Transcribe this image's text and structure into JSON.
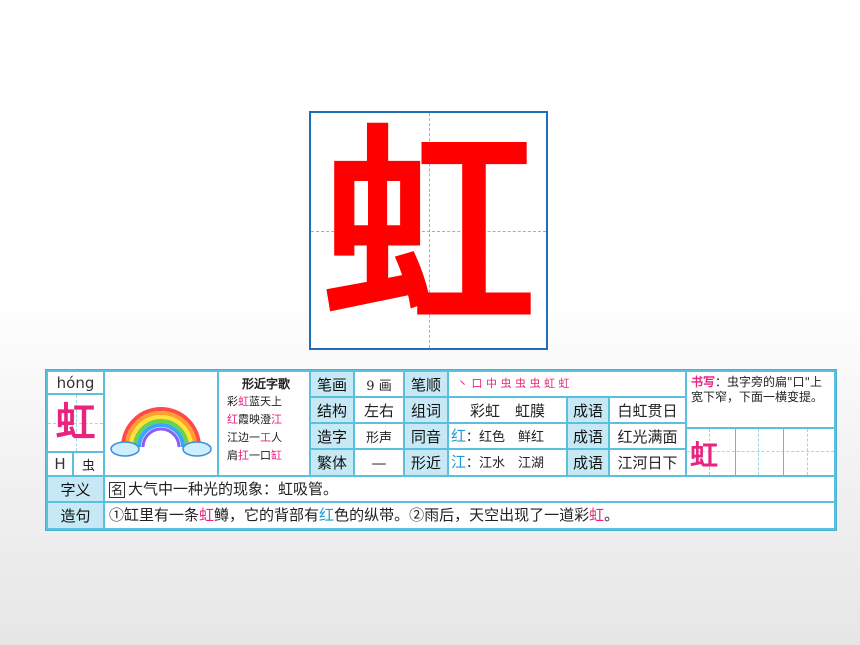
{
  "main_char": "虹",
  "card": {
    "pinyin": "hóng",
    "char": "虹",
    "index_letter": "H",
    "radical": "虫",
    "song": {
      "title": "形近字歌",
      "lines": [
        [
          {
            "t": "彩"
          },
          {
            "t": "虹",
            "c": "pk"
          },
          {
            "t": "蓝天上"
          }
        ],
        [
          {
            "t": "红",
            "c": "pk"
          },
          {
            "t": "霞映澄"
          },
          {
            "t": "江",
            "c": "pk"
          }
        ],
        [
          {
            "t": "江边一"
          },
          {
            "t": "工",
            "c": "pk"
          },
          {
            "t": "人"
          }
        ],
        [
          {
            "t": "肩"
          },
          {
            "t": "扛",
            "c": "pk"
          },
          {
            "t": "一口"
          },
          {
            "t": "缸",
            "c": "pk"
          }
        ]
      ]
    },
    "strokes_label": "笔画",
    "strokes_value": "9 画",
    "order_label": "笔顺",
    "order_value": "丶 口 中 虫 虫 虫 虹 虹",
    "structure_label": "结构",
    "structure_value": "左右",
    "words_label": "组词",
    "words_value": "彩虹　虹膜",
    "idiom_label": "成语",
    "idiom1": "白虹贯日",
    "method_label": "造字",
    "method_value": "形声",
    "homophone_label": "同音",
    "homophone_char": "红",
    "homophone_words": "：红色　鲜红",
    "idiom2": "红光满面",
    "traditional_label": "繁体",
    "traditional_value": "—",
    "similar_label": "形近",
    "similar_char": "江",
    "similar_words": "：江水　江湖",
    "idiom3": "江河日下",
    "writing_label": "书写",
    "writing_text": "：虫字旁的扁\"口\"上宽下窄，下面一横变提。",
    "writing_char": "虹",
    "meaning_label": "字义",
    "meaning_tag": "名",
    "meaning_text": "大气中一种光的现象：虹吸管。",
    "sentence_label": "造句",
    "sentence_parts": [
      {
        "t": "①缸里有一条"
      },
      {
        "t": "虹",
        "c": "pk"
      },
      {
        "t": "鳟，它的背部有"
      },
      {
        "t": "红",
        "c": "bl"
      },
      {
        "t": "色的纵带。②雨后，天空出现了一道彩"
      },
      {
        "t": "虹",
        "c": "pk"
      },
      {
        "t": "。"
      }
    ]
  },
  "colors": {
    "accent_pink": "#e8247f",
    "accent_blue": "#1e9ad6",
    "frame_blue": "#5bc0de",
    "big_char_red": "#ff0000"
  }
}
